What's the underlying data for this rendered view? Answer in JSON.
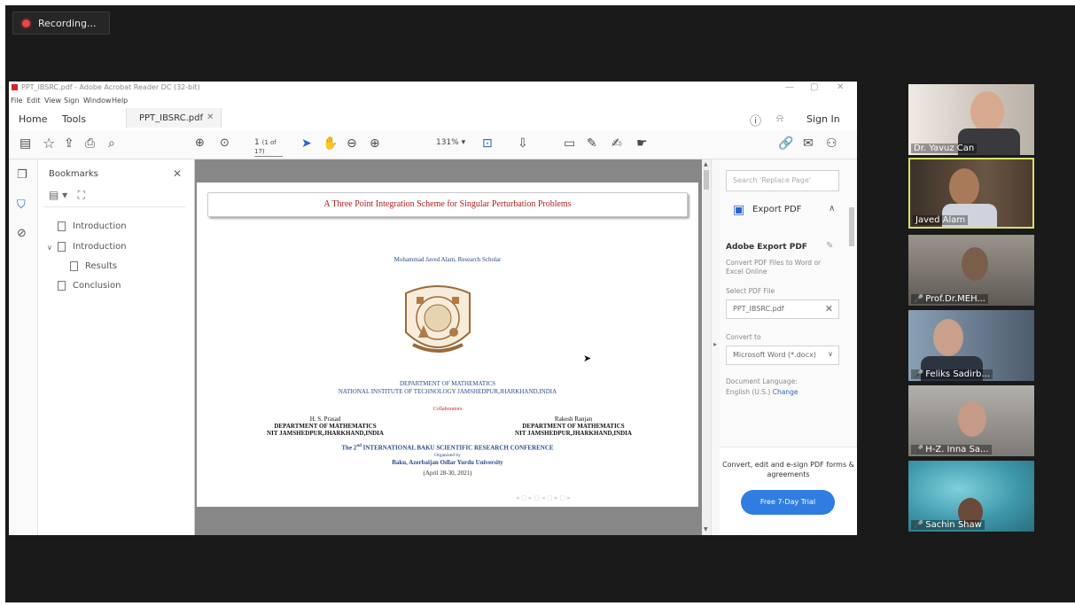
{
  "meeting": {
    "recording_label": "Recording..."
  },
  "acrobat": {
    "window_title": "PPT_IBSRC.pdf - Adobe Acrobat Reader DC (32-bit)",
    "menu": [
      "File",
      "Edit",
      "View",
      "Sign",
      "Window",
      "Help"
    ],
    "tabs": {
      "home": "Home",
      "tools": "Tools",
      "document": "PPT_IBSRC.pdf",
      "sign_in": "Sign In"
    },
    "toolbar": {
      "page_current": "1",
      "page_total": "(1 of 17)",
      "zoom": "131%"
    },
    "bookmarks": {
      "title": "Bookmarks",
      "items": [
        {
          "label": "Introduction"
        },
        {
          "label": "Introduction"
        },
        {
          "label": "Results"
        },
        {
          "label": "Conclusion"
        }
      ]
    },
    "page": {
      "title": "A Three Point Integration Scheme for Singular Perturbation Problems",
      "author": "Mohammad Javed Alam, Research Scholar",
      "department": "DEPARTMENT OF MATHEMATICS",
      "institute": "NATIONAL INSTITUTE OF TECHNOLOGY JAMSHEDPUR,JHARKHAND,INDIA",
      "collaborators_label": "Collaborators",
      "collab_left": {
        "name": "H. S. Prasad",
        "dept": "DEPARTMENT OF MATHEMATICS",
        "inst": "NIT JAMSHEDPUR,JHARKHAND,INDIA"
      },
      "collab_right": {
        "name": "Rakesh Ranjan",
        "dept": "DEPARTMENT OF MATHEMATICS",
        "inst": "NIT JAMSHEDPUR,JHARKHAND,INDIA"
      },
      "conference_pre": "The 2",
      "conference_sup": "nd",
      "conference_post": " INTERNATIONAL BAKU SCIENTIFIC RESEARCH CONFERENCE",
      "organized_by": "Organized by",
      "university": "Baku, Azerbaijan Odlar Yurdu University",
      "dates": "(April 28-30, 2021)"
    },
    "right_panel": {
      "search_placeholder": "Search 'Replace Page'",
      "export_pdf": "Export PDF",
      "adobe_export_heading": "Adobe Export PDF",
      "convert_desc": "Convert PDF Files to Word or Excel Online",
      "select_file_label": "Select PDF File",
      "selected_file": "PPT_IBSRC.pdf",
      "convert_to_label": "Convert to",
      "convert_to_value": "Microsoft Word (*.docx)",
      "doc_language_label": "Document Language:",
      "doc_language_value": "English (U.S.)",
      "change_link": "Change",
      "promo_text": "Convert, edit and e-sign PDF forms & agreements",
      "trial_button": "Free 7-Day Trial"
    }
  },
  "participants": [
    {
      "name": "Dr. Yavuz Can",
      "muted": false,
      "active": false,
      "bg": "#d9d4cf"
    },
    {
      "name": "Javed Alam",
      "muted": false,
      "active": true,
      "bg": "#57483a"
    },
    {
      "name": "Prof.Dr.MEH...",
      "muted": true,
      "active": false,
      "bg": "#6f6a62"
    },
    {
      "name": "Feliks Sadirb...",
      "muted": true,
      "active": false,
      "bg": "#5a6a7a"
    },
    {
      "name": "H-Z. Inna Sa...",
      "muted": true,
      "active": false,
      "bg": "#8a8784"
    },
    {
      "name": "Sachin Shaw",
      "muted": true,
      "active": false,
      "bg": "#3d8ea0"
    }
  ]
}
